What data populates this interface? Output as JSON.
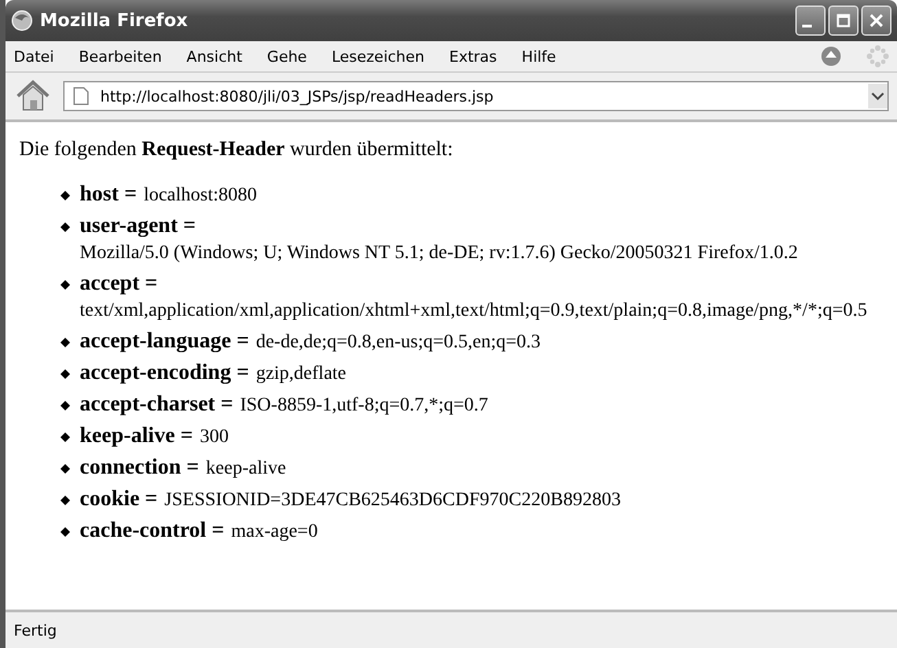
{
  "window": {
    "title": "Mozilla Firefox"
  },
  "menu": [
    "Datei",
    "Bearbeiten",
    "Ansicht",
    "Gehe",
    "Lesezeichen",
    "Extras",
    "Hilfe"
  ],
  "address": {
    "value": "http://localhost:8080/jli/03_JSPs/jsp/readHeaders.jsp"
  },
  "page": {
    "intro": "Die folgenden **Request-Header** wurden übermittelt:",
    "headers": [
      {
        "label": "host =",
        "value": "localhost:8080"
      },
      {
        "label": "user-agent =",
        "value": "Mozilla/5.0 (Windows; U; Windows NT 5.1; de-DE; rv:1.7.6) Gecko/20050321 Firefox/1.0.2"
      },
      {
        "label": "accept =",
        "value": "text/xml,application/xml,application/xhtml+xml,text/html;q=0.9,text/plain;q=0.8,image/png,*/*;q=0.5"
      },
      {
        "label": "accept-language =",
        "value": "de-de,de;q=0.8,en-us;q=0.5,en;q=0.3"
      },
      {
        "label": "accept-encoding =",
        "value": "gzip,deflate"
      },
      {
        "label": "accept-charset =",
        "value": "ISO-8859-1,utf-8;q=0.7,*;q=0.7"
      },
      {
        "label": "keep-alive =",
        "value": "300"
      },
      {
        "label": "connection =",
        "value": "keep-alive"
      },
      {
        "label": "cookie =",
        "value": "JSESSIONID=3DE47CB625463D6CDF970C220B892803"
      },
      {
        "label": "cache-control =",
        "value": "max-age=0"
      }
    ]
  },
  "status_bar": {
    "text": "Fertig"
  }
}
